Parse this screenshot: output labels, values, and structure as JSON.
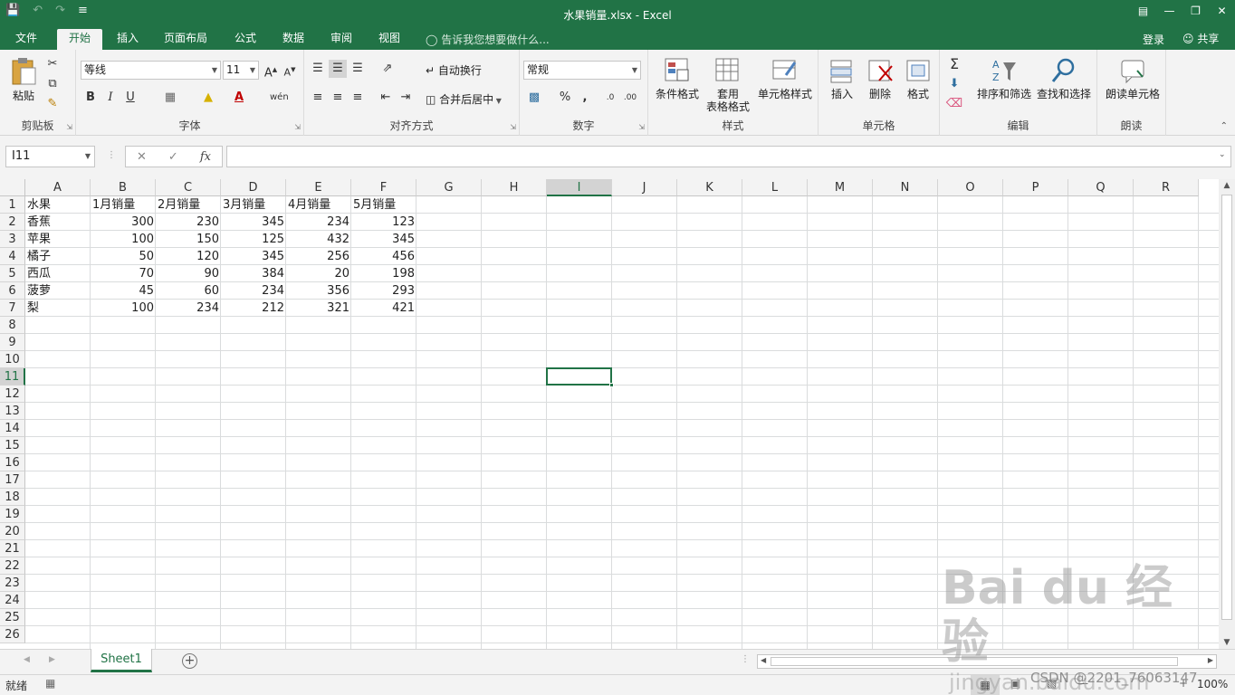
{
  "window": {
    "title": "水果销量.xlsx - Excel",
    "accent_color": "#217346"
  },
  "tabs": [
    "文件",
    "开始",
    "插入",
    "页面布局",
    "公式",
    "数据",
    "审阅",
    "视图"
  ],
  "tell_me": "告诉我您想要做什么...",
  "account": {
    "login": "登录",
    "share": "共享"
  },
  "ribbon": {
    "clipboard": {
      "paste": "粘贴",
      "label": "剪贴板"
    },
    "font": {
      "name": "等线",
      "size": "11",
      "label": "字体",
      "bold": "B",
      "italic": "I",
      "underline": "U"
    },
    "alignment": {
      "wrap": "自动换行",
      "merge": "合并后居中",
      "label": "对齐方式"
    },
    "number": {
      "format": "常规",
      "percent": "%",
      "comma": ",",
      "label": "数字"
    },
    "styles": {
      "conditional": "条件格式",
      "table_line1": "套用",
      "table_line2": "表格格式",
      "cell_styles": "单元格样式",
      "label": "样式"
    },
    "cells": {
      "insert": "插入",
      "delete": "删除",
      "format": "格式",
      "label": "单元格"
    },
    "editing": {
      "sort": "排序和筛选",
      "find": "查找和选择",
      "label": "编辑"
    },
    "speech": {
      "read": "朗读单元格",
      "label": "朗读"
    }
  },
  "formula_bar": {
    "name_box": "I11",
    "fx": "fx",
    "content": ""
  },
  "columns": [
    "A",
    "B",
    "C",
    "D",
    "E",
    "F",
    "G",
    "H",
    "I",
    "J",
    "K",
    "L",
    "M",
    "N",
    "O",
    "P",
    "Q",
    "R"
  ],
  "rows": [
    "1",
    "2",
    "3",
    "4",
    "5",
    "6",
    "7",
    "8",
    "9",
    "10",
    "11",
    "12",
    "13",
    "14",
    "15",
    "16",
    "17",
    "18",
    "19",
    "20",
    "21",
    "22",
    "23",
    "24",
    "25",
    "26"
  ],
  "selected_cell": "I11",
  "sheet": {
    "header": [
      "水果",
      "1月销量",
      "2月销量",
      "3月销量",
      "4月销量",
      "5月销量"
    ],
    "data": [
      [
        "香蕉",
        "300",
        "230",
        "345",
        "234",
        "123"
      ],
      [
        "苹果",
        "100",
        "150",
        "125",
        "432",
        "345"
      ],
      [
        "橘子",
        "50",
        "120",
        "345",
        "256",
        "456"
      ],
      [
        "西瓜",
        "70",
        "90",
        "384",
        "20",
        "198"
      ],
      [
        "菠萝",
        "45",
        "60",
        "234",
        "356",
        "293"
      ],
      [
        "梨",
        "100",
        "234",
        "212",
        "321",
        "421"
      ]
    ]
  },
  "sheet_tab": "Sheet1",
  "status": {
    "ready": "就绪",
    "zoom": "100%"
  },
  "watermark": {
    "main": "Bai du 经验",
    "sub": "jingyan.baidu.com"
  },
  "credit": "CSDN @2201_76063147"
}
